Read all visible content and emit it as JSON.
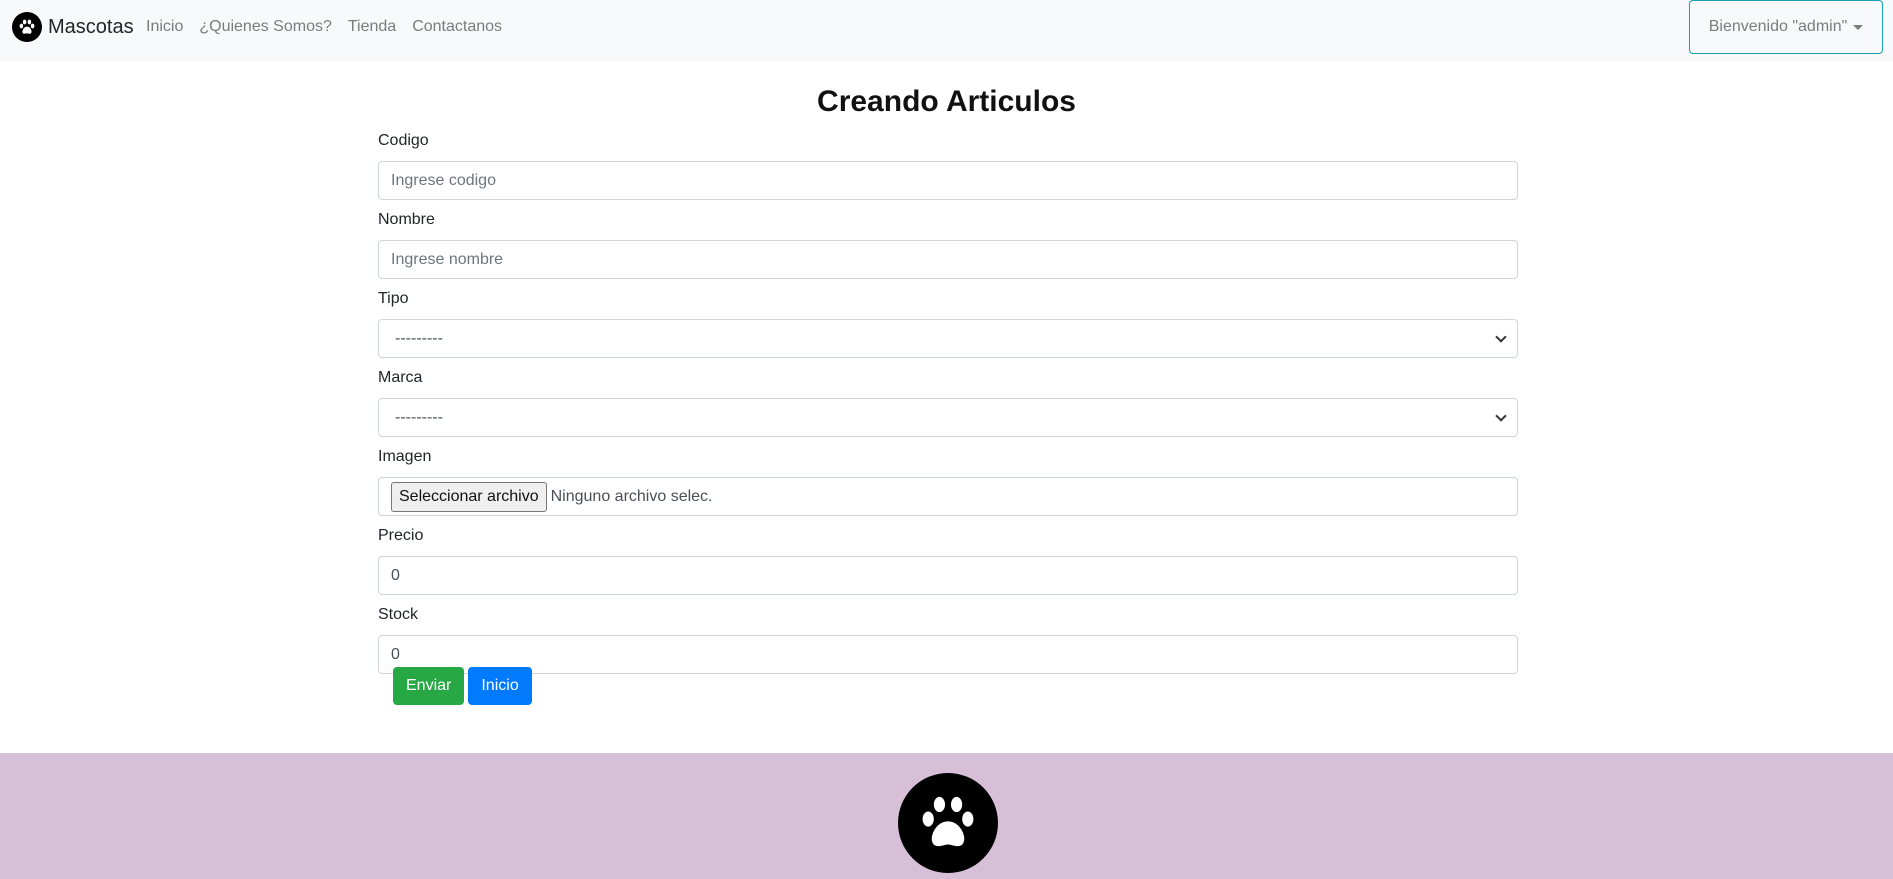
{
  "navbar": {
    "brand": "Mascotas",
    "brand_icon": "paw-icon",
    "links": [
      "Inicio",
      "¿Quienes Somos?",
      "Tienda",
      "Contactanos"
    ],
    "user_menu": "Bienvenido \"admin\""
  },
  "page": {
    "title": "Creando Articulos"
  },
  "form": {
    "codigo": {
      "label": "Codigo",
      "placeholder": "Ingrese codigo",
      "value": ""
    },
    "nombre": {
      "label": "Nombre",
      "placeholder": "Ingrese nombre",
      "value": ""
    },
    "tipo": {
      "label": "Tipo",
      "selected": "---------"
    },
    "marca": {
      "label": "Marca",
      "selected": "---------"
    },
    "imagen": {
      "label": "Imagen",
      "button": "Seleccionar archivo",
      "status": "Ninguno archivo selec."
    },
    "precio": {
      "label": "Precio",
      "value": "0"
    },
    "stock": {
      "label": "Stock",
      "value": "0"
    }
  },
  "actions": {
    "submit": "Enviar",
    "home": "Inicio"
  },
  "footer": {
    "logo_icon": "paw-icon"
  },
  "colors": {
    "navbar_bg": "#f8f9fa",
    "success": "#28a745",
    "primary": "#007bff",
    "footer_bg": "#d8bfd8",
    "dropdown_border": "#17a2b8"
  }
}
